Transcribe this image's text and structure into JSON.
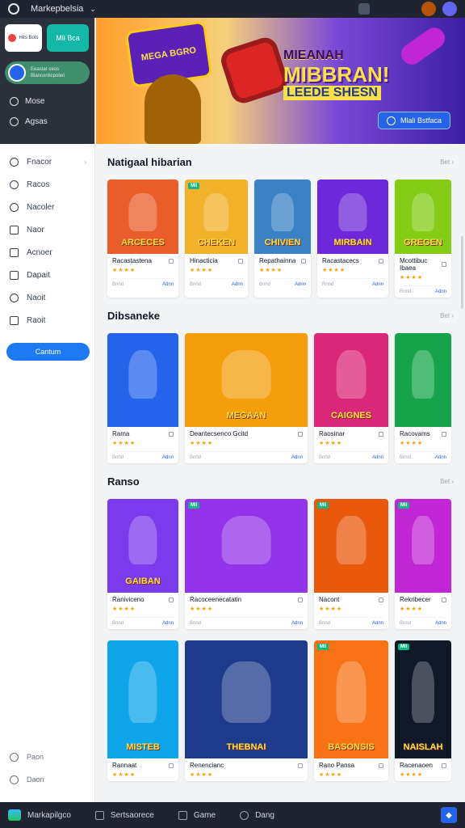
{
  "topbar": {
    "title": "Markepbelsia"
  },
  "sidebar": {
    "card_small": "Hits Bots",
    "card_teal": "Mli Bca",
    "promo_line1": "Eeastar ceos",
    "promo_line2": "Blanconticpoleri",
    "dark_items": [
      {
        "label": "Mose",
        "icon": "search-icon"
      },
      {
        "label": "Agsas",
        "icon": "user-icon"
      }
    ],
    "items": [
      {
        "label": "Fnacor",
        "icon": "smile-icon",
        "arrow": "›"
      },
      {
        "label": "Racos",
        "icon": "clock-icon"
      },
      {
        "label": "Nacoler",
        "icon": "chat-icon"
      },
      {
        "label": "Naor",
        "icon": "file-icon"
      },
      {
        "label": "Acnoer",
        "icon": "image-icon"
      },
      {
        "label": "Dapait",
        "icon": "lock-icon"
      },
      {
        "label": "Naoit",
        "icon": "gear-icon"
      },
      {
        "label": "Raoit",
        "icon": "doc-icon"
      }
    ],
    "cta": "Cantum",
    "bottom_items": [
      {
        "label": "Paon",
        "icon": "help-icon"
      },
      {
        "label": "Daon",
        "icon": "settings-icon"
      }
    ]
  },
  "hero": {
    "badge": "MEGA BGRO",
    "title_line1": "MIEANAH",
    "title_line2": "MIBBRAN!",
    "title_line3": "LEEDE SHESN",
    "cta": "Mlali Bstfaca"
  },
  "sections": [
    {
      "title": "Natigaal hibarian",
      "more": "Bet ›",
      "cards": [
        {
          "art": "ARCECES",
          "tag": "",
          "name": "Racastastena",
          "rating": "★★★★",
          "meta": "Bnnd",
          "price": "Adnn",
          "bg": "#e85d2a"
        },
        {
          "art": "CHEKEN",
          "tag": "Mli",
          "name": "Hinacticia",
          "rating": "★★★★",
          "meta": "Bnnd",
          "price": "Adnn",
          "bg": "#f2b12a"
        },
        {
          "art": "CHIVIEN",
          "tag": "",
          "name": "Repathainna",
          "rating": "★★★★",
          "meta": "Bnnd",
          "price": "Adnn",
          "bg": "#3b82c4"
        },
        {
          "art": "MIRBAIN",
          "tag": "",
          "name": "Racastacecs",
          "rating": "★★★★",
          "meta": "Rnnd",
          "price": "Adnn",
          "bg": "#6d28d9"
        },
        {
          "art": "GREGEN",
          "tag": "",
          "name": "Mcottibuc Ibaea",
          "rating": "★★★★",
          "meta": "Rnnd",
          "price": "Adnn",
          "bg": "#84cc16"
        }
      ]
    },
    {
      "title": "Dibsaneke",
      "more": "Bet ›",
      "cards": [
        {
          "art": "",
          "tag": "",
          "name": "Rama",
          "rating": "★★★★",
          "meta": "Bnnd",
          "price": "Adnn",
          "bg": "#2563eb"
        },
        {
          "art": "MEGAAN",
          "tag": "",
          "name": "Deantecsenco Gcitd",
          "rating": "★★★★",
          "meta": "Bnnd",
          "price": "Adnn",
          "bg": "#f59e0b"
        },
        {
          "art": "CAIGNES",
          "tag": "",
          "name": "Raosinar",
          "rating": "★★★★",
          "meta": "Bnnd",
          "price": "Adnn",
          "bg": "#db2777"
        },
        {
          "art": "",
          "tag": "",
          "name": "Racovams",
          "rating": "★★★★",
          "meta": "Bnnd",
          "price": "Adnn",
          "bg": "#16a34a"
        }
      ]
    },
    {
      "title": "Ranso",
      "more": "Bet ›",
      "cards": [
        {
          "art": "GAIBAN",
          "tag": "",
          "name": "Raniviceno",
          "rating": "★★★★",
          "meta": "Bnnd",
          "price": "Adnn",
          "bg": "#7c3aed"
        },
        {
          "art": "",
          "tag": "Mli",
          "name": "Racoceenecatatin",
          "rating": "★★★★",
          "meta": "Bnnd",
          "price": "Adnn",
          "bg": "#9333ea"
        },
        {
          "art": "",
          "tag": "Mli",
          "name": "Nacont",
          "rating": "★★★★",
          "meta": "Bnnd",
          "price": "Adnn",
          "bg": "#ea580c"
        },
        {
          "art": "",
          "tag": "Mli",
          "name": "Rekribecer",
          "rating": "★★★★",
          "meta": "Bnnd",
          "price": "Adnn",
          "bg": "#c026d3"
        }
      ]
    },
    {
      "title": "",
      "more": "",
      "cards": [
        {
          "art": "MISTEB",
          "tag": "",
          "name": "Rannaat",
          "rating": "★★★★",
          "meta": "",
          "price": "",
          "bg": "#0ea5e9"
        },
        {
          "art": "THEBNAI",
          "tag": "",
          "name": "Renencianc",
          "rating": "★★★★",
          "meta": "",
          "price": "",
          "bg": "#1e3a8a"
        },
        {
          "art": "BASONSIS",
          "tag": "Mli",
          "name": "Rano Pansa",
          "rating": "★★★★",
          "meta": "",
          "price": "",
          "bg": "#f97316"
        },
        {
          "art": "NAISLAH",
          "tag": "Mli",
          "name": "Racenaoen",
          "rating": "★★★★",
          "meta": "",
          "price": "",
          "bg": "#111827"
        }
      ]
    }
  ],
  "bottombar": {
    "items": [
      {
        "label": "Markapilgco",
        "icon": "app-logo-icon"
      },
      {
        "label": "Sertsaorece",
        "icon": "grid-icon"
      },
      {
        "label": "Game",
        "icon": "gamepad-icon"
      },
      {
        "label": "Dang",
        "icon": "globe-icon"
      }
    ]
  }
}
